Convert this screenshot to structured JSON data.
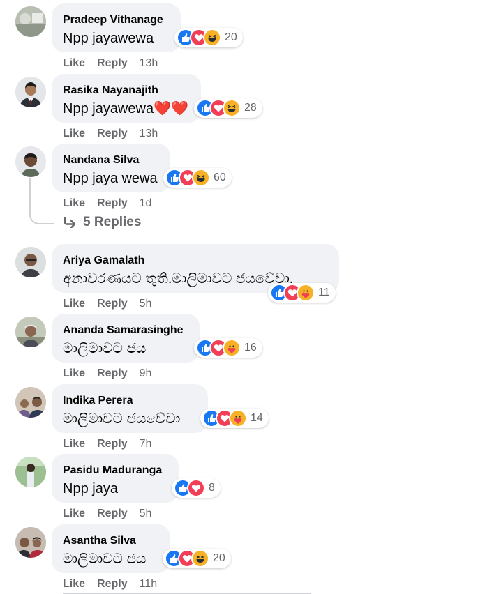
{
  "comments": [
    {
      "author": "Pradeep Vithanage",
      "text": "Npp jayawewa",
      "reactions": [
        "like",
        "love",
        "haha"
      ],
      "count": "20",
      "like": "Like",
      "reply": "Reply",
      "time": "13h"
    },
    {
      "author": "Rasika Nayanajith",
      "text": "Npp jayawewa❤️❤️",
      "reactions": [
        "like",
        "love",
        "haha"
      ],
      "count": "28",
      "like": "Like",
      "reply": "Reply",
      "time": "13h"
    },
    {
      "author": "Nandana Silva",
      "text": "Npp jaya wewa",
      "reactions": [
        "like",
        "love",
        "haha"
      ],
      "count": "60",
      "like": "Like",
      "reply": "Reply",
      "time": "1d"
    },
    {
      "author": "Ariya Gamalath",
      "text": "අනාවරණයට තුති.මාලිමාවට ජයවේවා.",
      "reactions": [
        "like",
        "love",
        "care"
      ],
      "count": "11",
      "like": "Like",
      "reply": "Reply",
      "time": "5h"
    },
    {
      "author": "Ananda Samarasinghe",
      "text": "මාලිමාවට ජය",
      "reactions": [
        "like",
        "love",
        "care"
      ],
      "count": "16",
      "like": "Like",
      "reply": "Reply",
      "time": "9h"
    },
    {
      "author": "Indika Perera",
      "text": "මාලිමාවට ජයවේවා",
      "reactions": [
        "like",
        "love",
        "care"
      ],
      "count": "14",
      "like": "Like",
      "reply": "Reply",
      "time": "7h"
    },
    {
      "author": "Pasidu Maduranga",
      "text": "Npp jaya",
      "reactions": [
        "like",
        "love"
      ],
      "count": "8",
      "like": "Like",
      "reply": "Reply",
      "time": "5h"
    },
    {
      "author": "Asantha Silva",
      "text": "මාලිමාවට ජය",
      "reactions": [
        "like",
        "love",
        "haha"
      ],
      "count": "20",
      "like": "Like",
      "reply": "Reply",
      "time": "11h"
    }
  ],
  "replies_link": "5 Replies",
  "colors": {
    "like": "#1877f2",
    "love": "#f33e58",
    "haha": "#f7b125",
    "care": "#f7b125",
    "bubble": "#f0f2f5",
    "meta": "#65676b"
  }
}
